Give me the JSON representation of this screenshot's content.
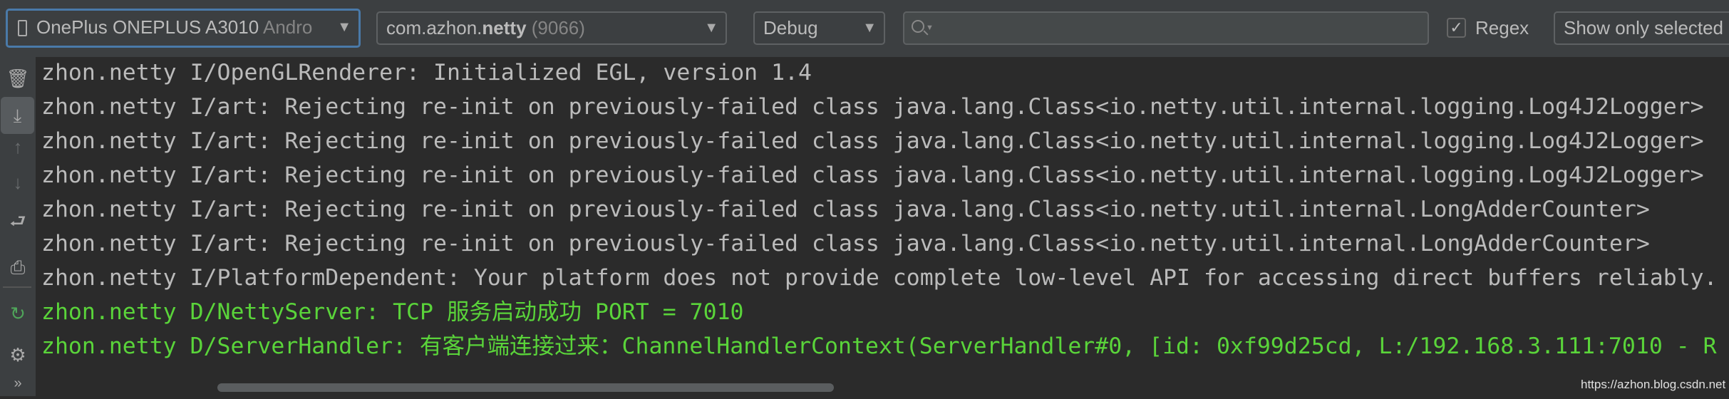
{
  "toolbar": {
    "device": {
      "name": "OnePlus ONEPLUS A3010",
      "suffix": "Andro",
      "icon": "phone-icon"
    },
    "process": {
      "package_prefix": "com.azhon.",
      "package_bold": "netty",
      "pid": "(9066)"
    },
    "log_level": "Debug",
    "search": {
      "value": "",
      "placeholder": ""
    },
    "regex": {
      "label": "Regex",
      "checked": true,
      "check_glyph": "✓"
    },
    "filter": "Show only selected"
  },
  "sidebar": {
    "icons": [
      "trash-icon",
      "scroll-to-end-icon",
      "up-arrow-icon",
      "down-arrow-icon",
      "soft-wrap-icon",
      "print-icon",
      "restart-icon",
      "settings-icon",
      "more-icon"
    ],
    "glyphs": {
      "trash": "🗑",
      "scroll": "⤓",
      "up": "↑",
      "down": "↓",
      "wrap": "⮐",
      "print": "⎙",
      "restart": "↻",
      "gear": "⚙",
      "more": "»"
    }
  },
  "log": {
    "lines": [
      {
        "text": "zhon.netty I/OpenGLRenderer: Initialized EGL, version 1.4",
        "level": "info"
      },
      {
        "text": "zhon.netty I/art: Rejecting re-init on previously-failed class java.lang.Class<io.netty.util.internal.logging.Log4J2Logger>",
        "level": "info"
      },
      {
        "text": "zhon.netty I/art: Rejecting re-init on previously-failed class java.lang.Class<io.netty.util.internal.logging.Log4J2Logger>",
        "level": "info"
      },
      {
        "text": "zhon.netty I/art: Rejecting re-init on previously-failed class java.lang.Class<io.netty.util.internal.logging.Log4J2Logger>",
        "level": "info"
      },
      {
        "text": "zhon.netty I/art: Rejecting re-init on previously-failed class java.lang.Class<io.netty.util.internal.LongAdderCounter>",
        "level": "info"
      },
      {
        "text": "zhon.netty I/art: Rejecting re-init on previously-failed class java.lang.Class<io.netty.util.internal.LongAdderCounter>",
        "level": "info"
      },
      {
        "text": "zhon.netty I/PlatformDependent: Your platform does not provide complete low-level API for accessing direct buffers reliably.",
        "level": "info"
      },
      {
        "text": "zhon.netty D/NettyServer: TCP 服务启动成功 PORT = 7010",
        "level": "debug"
      },
      {
        "text": "zhon.netty D/ServerHandler: 有客户端连接过来：ChannelHandlerContext(ServerHandler#0, [id: 0xf99d25cd, L:/192.168.3.111:7010 - R",
        "level": "debug"
      }
    ]
  },
  "colors": {
    "info": "#bbbbbb",
    "debug": "#5ad43a",
    "accent": "#4a7aa9"
  },
  "watermark": "https://azhon.blog.csdn.net"
}
